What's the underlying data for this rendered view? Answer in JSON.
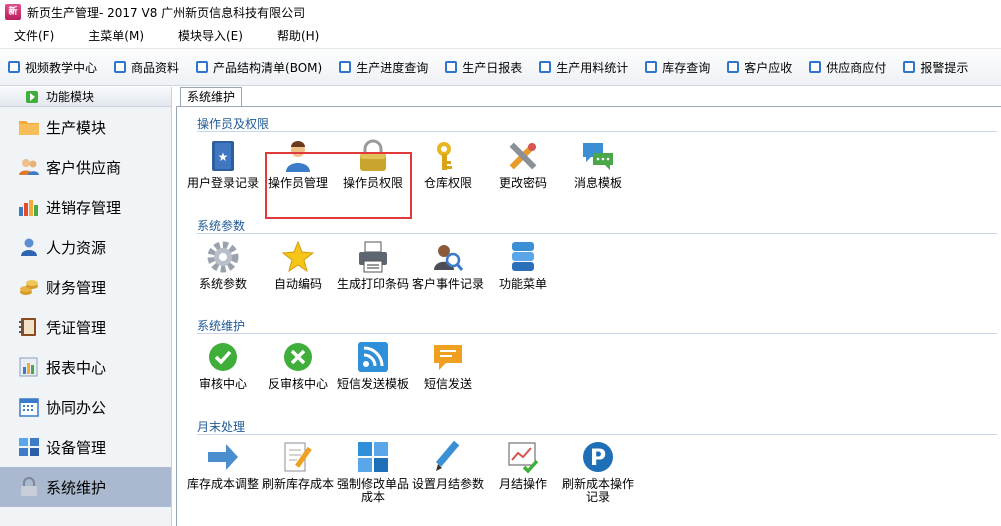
{
  "window": {
    "title": "新页生产管理- 2017 V8 广州新页信息科技有限公司",
    "logo_text": "新"
  },
  "menu": [
    "文件(F)",
    "主菜单(M)",
    "模块导入(E)",
    "帮助(H)"
  ],
  "toolbar": [
    "视频教学中心",
    "商品资料",
    "产品结构清单(BOM)",
    "生产进度查询",
    "生产日报表",
    "生产用料统计",
    "库存查询",
    "客户应收",
    "供应商应付",
    "报警提示"
  ],
  "left_panel": {
    "header": "功能模块",
    "items": [
      {
        "label": "生产模块",
        "icon": "folder-icon"
      },
      {
        "label": "客户供应商",
        "icon": "people-icon"
      },
      {
        "label": "进销存管理",
        "icon": "bar-chart-icon"
      },
      {
        "label": "人力资源",
        "icon": "person-icon"
      },
      {
        "label": "财务管理",
        "icon": "coins-icon"
      },
      {
        "label": "凭证管理",
        "icon": "ledger-icon"
      },
      {
        "label": "报表中心",
        "icon": "report-icon"
      },
      {
        "label": "协同办公",
        "icon": "calendar-icon"
      },
      {
        "label": "设备管理",
        "icon": "window-icon"
      },
      {
        "label": "系统维护",
        "icon": "lock-icon",
        "active": true
      }
    ]
  },
  "tab": {
    "label": "系统维护"
  },
  "sections": [
    {
      "title": "操作员及权限",
      "tiles": [
        "用户登录记录",
        "操作员管理",
        "操作员权限",
        "仓库权限",
        "更改密码",
        "消息模板"
      ]
    },
    {
      "title": "系统参数",
      "tiles": [
        "系统参数",
        "自动编码",
        "生成打印条码",
        "客户事件记录",
        "功能菜单"
      ]
    },
    {
      "title": "系统维护",
      "tiles": [
        "审核中心",
        "反审核中心",
        "短信发送模板",
        "短信发送"
      ]
    },
    {
      "title": "月末处理",
      "tiles": [
        "库存成本调整",
        "刷新库存成本",
        "强制修改单品成本",
        "设置月结参数",
        "月结操作",
        "刷新成本操作记录"
      ]
    }
  ],
  "colors": {
    "highlight": "#e03a3a",
    "section_title": "#1f5a96",
    "active_item": "#aab9cf"
  }
}
